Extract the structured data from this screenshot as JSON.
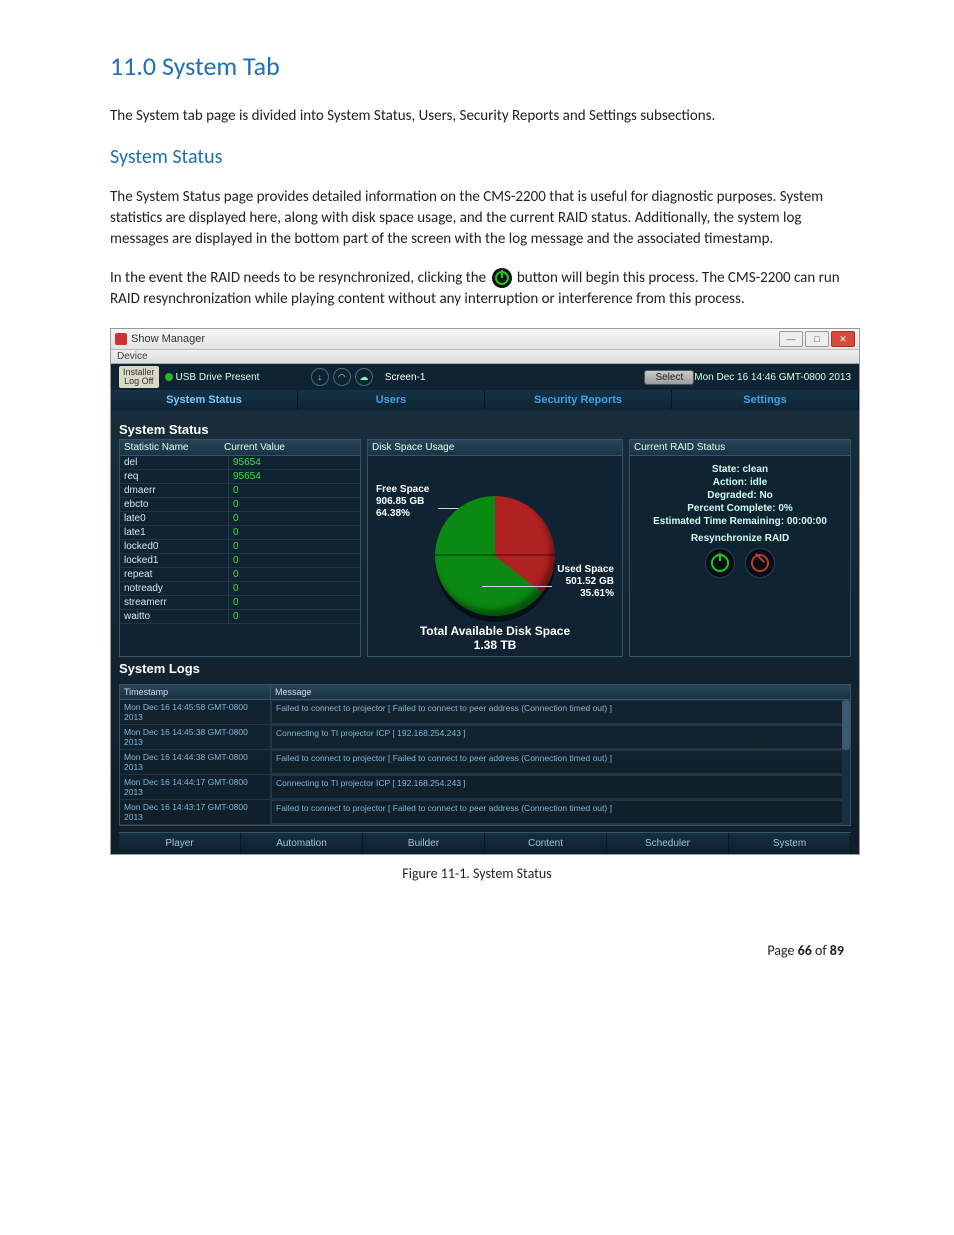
{
  "doc": {
    "heading": "11.0 System Tab",
    "para1": "The System tab page is divided into System Status, Users, Security Reports and Settings subsections.",
    "sub1": "System Status",
    "para2": "The System Status page provides detailed information on the CMS-2200 that is useful for diagnostic purposes.  System statistics are displayed here, along with disk space usage, and the current RAID status.  Additionally, the system log messages are displayed in the bottom part of the screen with the log message and the associated timestamp.",
    "para3a": "In the event the RAID needs to be resynchronized, clicking the ",
    "para3b": " button will begin this process.  The CMS-2200 can run RAID resynchronization while playing content without any interruption or interference from this process.",
    "figcaption": "Figure 11-1.  System Status",
    "footer_pre": "Page ",
    "footer_cur": "66",
    "footer_mid": " of ",
    "footer_tot": "89"
  },
  "app": {
    "title": "Show Manager",
    "menu": "Device",
    "installer_top": "Installer",
    "installer_bot": "Log Off",
    "usb": "USB Drive Present",
    "screen": "Screen-1",
    "select": "Select",
    "clock": "Mon Dec 16 14:46 GMT-0800 2013",
    "tabs": [
      "System Status",
      "Users",
      "Security Reports",
      "Settings"
    ],
    "content_title": "System Status",
    "stat_hdr_name": "Statistic Name",
    "stat_hdr_val": "Current Value",
    "stats": [
      {
        "n": "del",
        "v": "95654"
      },
      {
        "n": "req",
        "v": "95654"
      },
      {
        "n": "dmaerr",
        "v": "0"
      },
      {
        "n": "ebcto",
        "v": "0"
      },
      {
        "n": "late0",
        "v": "0"
      },
      {
        "n": "late1",
        "v": "0"
      },
      {
        "n": "locked0",
        "v": "0"
      },
      {
        "n": "locked1",
        "v": "0"
      },
      {
        "n": "repeat",
        "v": "0"
      },
      {
        "n": "notready",
        "v": "0"
      },
      {
        "n": "streamerr",
        "v": "0"
      },
      {
        "n": "waitto",
        "v": "0"
      }
    ],
    "disk": {
      "hdr": "Disk Space Usage",
      "free_title": "Free Space",
      "free_gb": "906.85 GB",
      "free_pct": "64.38%",
      "used_title": "Used Space",
      "used_gb": "501.52 GB",
      "used_pct": "35.61%",
      "total_title": "Total Available Disk Space",
      "total_val": "1.38 TB"
    },
    "raid": {
      "hdr": "Current RAID Status",
      "state": "State: clean",
      "action": "Action: idle",
      "degraded": "Degraded: No",
      "pct": "Percent Complete: 0%",
      "eta": "Estimated Time Remaining: 00:00:00",
      "resync": "Resynchronize RAID"
    },
    "logs_title": "System Logs",
    "logs_hdr_ts": "Timestamp",
    "logs_hdr_msg": "Message",
    "logs": [
      {
        "t": "Mon Dec 16 14:45:58 GMT-0800 2013",
        "m": "Failed to connect to projector [ Failed to connect to peer address (Connection timed out) ]"
      },
      {
        "t": "Mon Dec 16 14:45:38 GMT-0800 2013",
        "m": "Connecting to TI projector ICP [ 192.168.254.243 ]"
      },
      {
        "t": "Mon Dec 16 14:44:38 GMT-0800 2013",
        "m": "Failed to connect to projector [ Failed to connect to peer address (Connection timed out) ]"
      },
      {
        "t": "Mon Dec 16 14:44:17 GMT-0800 2013",
        "m": "Connecting to TI projector ICP [ 192.168.254.243 ]"
      },
      {
        "t": "Mon Dec 16 14:43:17 GMT-0800 2013",
        "m": "Failed to connect to projector [ Failed to connect to peer address (Connection timed out) ]"
      }
    ],
    "bottom_tabs": [
      "Player",
      "Automation",
      "Builder",
      "Content",
      "Scheduler",
      "System"
    ]
  }
}
